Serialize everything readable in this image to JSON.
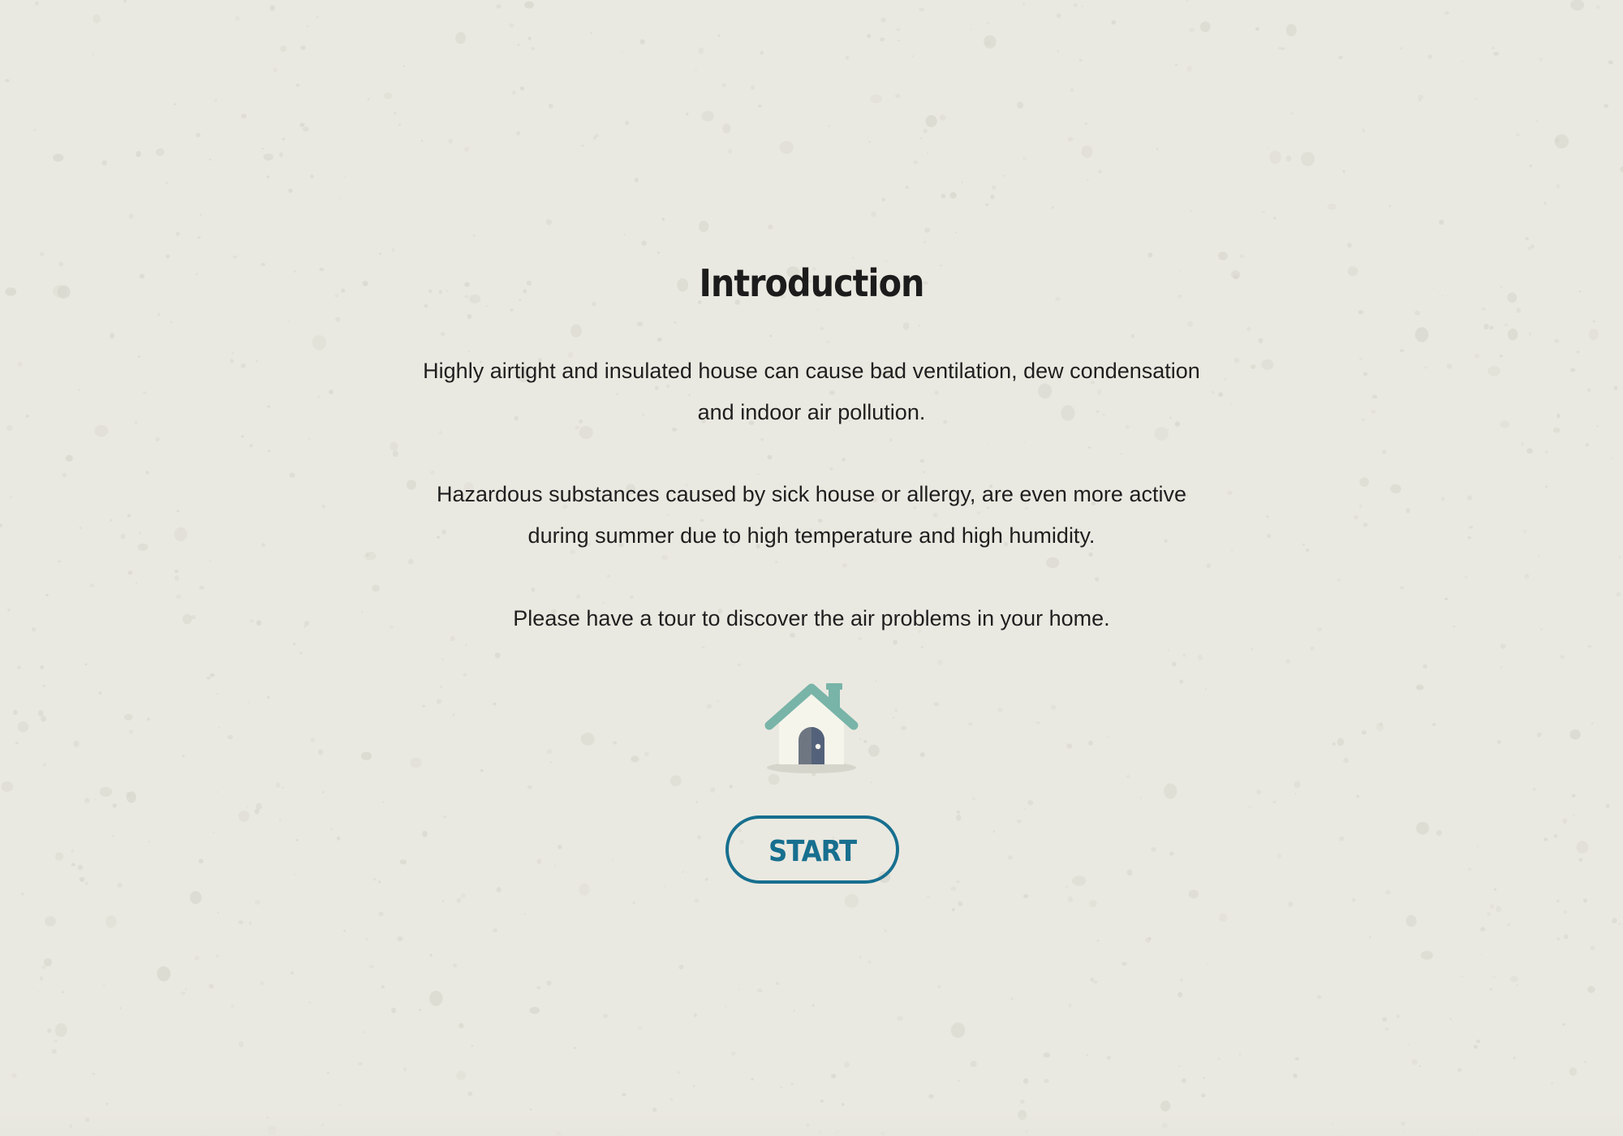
{
  "intro": {
    "title": "Introduction",
    "paragraphs": [
      "Highly airtight and insulated house can cause bad ventilation, dew condensation and indoor air pollution.",
      "Hazardous substances caused by sick house or allergy, are even more active during summer due to high temperature and high humidity.",
      "Please have a tour to discover the air problems in your home."
    ],
    "icon": "house-icon",
    "start_label": "START"
  },
  "colors": {
    "background": "#eae9e1",
    "accent": "#176f8f",
    "roof": "#79b4a8",
    "text": "#1f1f1f"
  }
}
